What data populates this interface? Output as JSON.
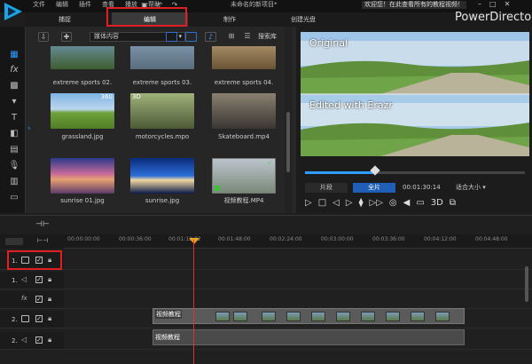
{
  "menu": [
    "文件",
    "编辑",
    "插件",
    "查看",
    "播放",
    "帮助"
  ],
  "document_title": "未命名的新项目*",
  "welcome_message": "欢迎您！在此查看所有的教程视频！",
  "brand": "PowerDirector",
  "modes": [
    "捕捉",
    "编辑",
    "制作",
    "创建光盘"
  ],
  "active_mode": "编辑",
  "library": {
    "dropdown_value": "媒体内容",
    "search_label": "搜索库",
    "items": [
      {
        "label": "extreme sports 02.",
        "badge": ""
      },
      {
        "label": "extreme sports 03.",
        "badge": ""
      },
      {
        "label": "extreme sports 04.",
        "badge": ""
      },
      {
        "label": "grassland.jpg",
        "badge": "360"
      },
      {
        "label": "motorcycles.mpo",
        "badge": "3D"
      },
      {
        "label": "Skateboard.mp4",
        "badge": ""
      },
      {
        "label": "sunrise 01.jpg",
        "badge": ""
      },
      {
        "label": "sunrise.jpg",
        "badge": ""
      },
      {
        "label": "视频教程.MP4",
        "badge": "✓"
      }
    ]
  },
  "preview": {
    "overlay_top": "Original",
    "overlay_bottom": "Edited with Erazr",
    "clip_mode": "片段",
    "movie_mode": "全片",
    "timecode": "00:01:30:14",
    "zoom": "适合大小",
    "three_d": "3D",
    "seek_progress": 0.32
  },
  "timeline": {
    "ruler": [
      "00:00:00:00",
      "00:00:36:00",
      "00:01:12:02",
      "00:01:48:00",
      "00:02:24:00",
      "00:03:00:00",
      "00:03:36:00",
      "00:04:12:00",
      "00:04:48:00"
    ],
    "tracks": [
      {
        "number": "1."
      },
      {
        "number": "1."
      },
      {
        "number": ""
      },
      {
        "number": "2."
      },
      {
        "number": "2."
      }
    ],
    "video_clip_label": "视频教程",
    "audio_clip_label": "视频教程"
  },
  "colors": {
    "accent": "#2f9cff",
    "highlight_box": "#e02020",
    "playhead": "#e03030"
  }
}
